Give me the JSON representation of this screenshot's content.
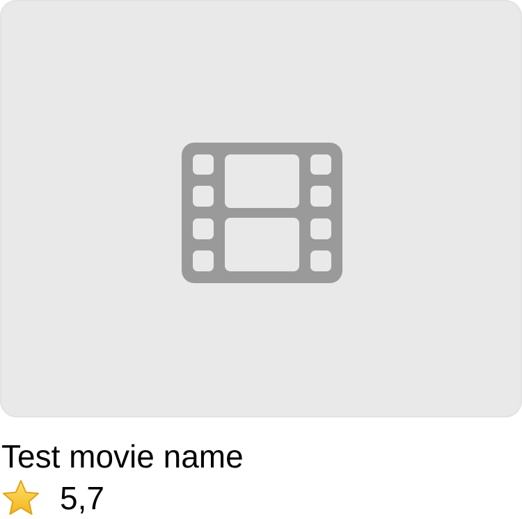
{
  "movie": {
    "title": "Test movie name",
    "rating": "5,7"
  },
  "poster": {
    "placeholder_icon": "film-icon",
    "background_color": "#e9e9e9",
    "icon_color": "#9a9a9a"
  },
  "rating": {
    "icon": "star-icon",
    "star_color": "#f7c531"
  }
}
